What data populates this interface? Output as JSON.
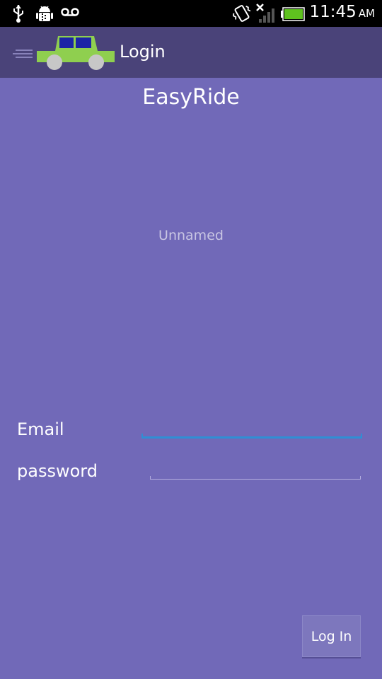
{
  "status_bar": {
    "time": "11:45",
    "ampm": "AM",
    "icons": [
      "usb-icon",
      "android-debug-icon",
      "voicemail-icon",
      "vibrate-icon",
      "no-signal-icon",
      "battery-icon"
    ]
  },
  "action_bar": {
    "title": "Login",
    "logo": "car-icon",
    "nav_icon": "drawer-icon"
  },
  "main": {
    "app_title": "EasyRide",
    "image_label": "Unnamed"
  },
  "form": {
    "email_label": "Email",
    "email_value": "",
    "password_label": "password",
    "password_value": "",
    "login_button": "Log In"
  },
  "colors": {
    "background": "#7169b8",
    "action_bar": "#4a4379",
    "focus_underline": "#2f8fd4",
    "car_body": "#8fcf4f"
  }
}
